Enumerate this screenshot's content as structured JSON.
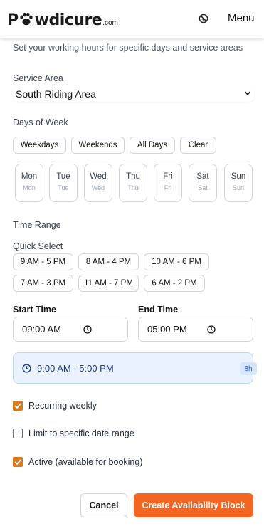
{
  "header": {
    "logo_main": "wdicure",
    "logo_suffix": ".com",
    "menu_label": "Menu",
    "icons": {
      "brand": "paw-icon",
      "status": "no-pets-icon"
    }
  },
  "intro": "Set your working hours for specific days and service areas",
  "service_area": {
    "label": "Service Area",
    "selected": "South Riding Area"
  },
  "days": {
    "label": "Days of Week",
    "quick": [
      "Weekdays",
      "Weekends",
      "All Days",
      "Clear"
    ],
    "items": [
      {
        "name": "Mon",
        "sub": "Mon"
      },
      {
        "name": "Tue",
        "sub": "Tue"
      },
      {
        "name": "Wed",
        "sub": "Wed"
      },
      {
        "name": "Thu",
        "sub": "Thu"
      },
      {
        "name": "Fri",
        "sub": "Fri"
      },
      {
        "name": "Sat",
        "sub": "Sat"
      },
      {
        "name": "Sun",
        "sub": "Sun"
      }
    ]
  },
  "time_range": {
    "label": "Time Range",
    "quick_select_label": "Quick Select",
    "presets": [
      "9 AM - 5 PM",
      "8 AM - 4 PM",
      "10 AM - 6 PM",
      "7 AM - 3 PM",
      "11 AM - 7 PM",
      "6 AM - 2 PM"
    ],
    "start_label": "Start Time",
    "start_value": "09:00 AM",
    "end_label": "End Time",
    "end_value": "05:00 PM"
  },
  "summary": {
    "text": "9:00 AM - 5:00 PM",
    "duration": "8h"
  },
  "options": [
    {
      "label": "Recurring weekly",
      "checked": true
    },
    {
      "label": "Limit to specific date range",
      "checked": false
    },
    {
      "label": "Active (available for booking)",
      "checked": true
    }
  ],
  "actions": {
    "cancel": "Cancel",
    "create": "Create Availability Block"
  },
  "colors": {
    "accent": "#f26522",
    "checkbox": "#d97a1f",
    "summary_bg": "#eaf3fd"
  }
}
